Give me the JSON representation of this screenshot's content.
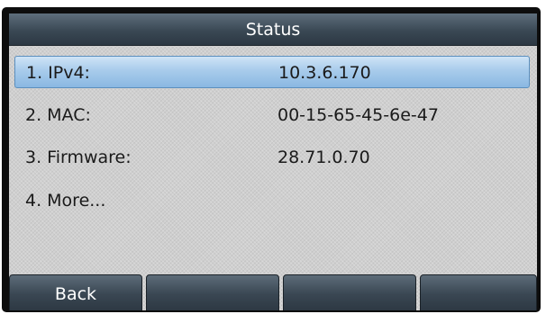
{
  "header": {
    "title": "Status"
  },
  "menu": {
    "items": [
      {
        "label": "1. IPv4:",
        "value": "10.3.6.170",
        "selected": true
      },
      {
        "label": "2. MAC:",
        "value": "00-15-65-45-6e-47",
        "selected": false
      },
      {
        "label": "3. Firmware:",
        "value": "28.71.0.70",
        "selected": false
      },
      {
        "label": "4. More...",
        "value": "",
        "selected": false
      }
    ]
  },
  "softkeys": {
    "labels": [
      "Back",
      "",
      "",
      ""
    ]
  },
  "colors": {
    "title_bar": "#3a4854",
    "selection_highlight": "#a8cbeb",
    "screen_background": "#cfcfcf",
    "softkey": "#3a4753"
  }
}
